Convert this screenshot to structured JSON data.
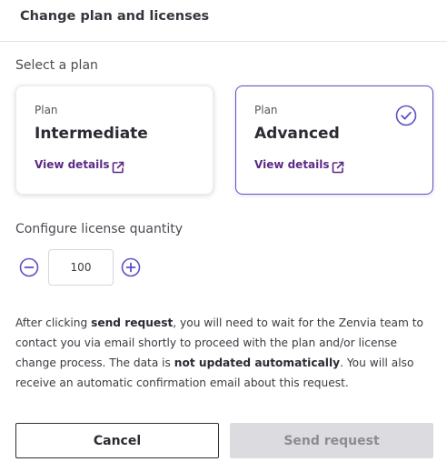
{
  "dialog": {
    "title": "Change plan and licenses"
  },
  "plan_section": {
    "label": "Select a plan",
    "plans": [
      {
        "kicker": "Plan",
        "name": "Intermediate",
        "link": "View details",
        "selected": false
      },
      {
        "kicker": "Plan",
        "name": "Advanced",
        "link": "View details",
        "selected": true
      }
    ]
  },
  "license_section": {
    "label": "Configure license quantity",
    "quantity": "100"
  },
  "info": {
    "part1": "After clicking ",
    "bold1": "send request",
    "part2": ", you will need to wait for the Zenvia team to contact you via email shortly to proceed with the plan and/or license change process. The data is ",
    "bold2": "not updated automatically",
    "part3": ". You will also receive an automatic confirmation email about this request."
  },
  "actions": {
    "cancel": "Cancel",
    "send": "Send request"
  },
  "colors": {
    "accent": "#5c4fc4",
    "link": "#5b2a86",
    "disabled_bg": "#dcdce0",
    "disabled_text": "#8b8b92"
  }
}
